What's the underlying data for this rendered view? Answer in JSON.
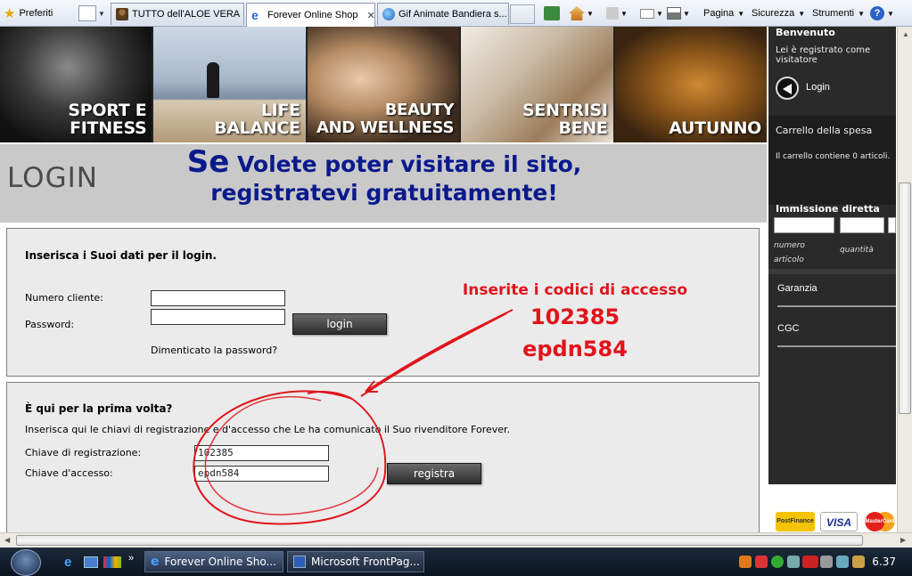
{
  "browser": {
    "favorites_label": "Preferiti",
    "tabs": [
      {
        "title": "TUTTO dell'ALOE VERA"
      },
      {
        "title": "Forever Online Shop",
        "active": true
      },
      {
        "title": "Gif Animate Bandiera s..."
      }
    ],
    "commands": {
      "page": "Pagina",
      "security": "Sicurezza",
      "tools": "Strumenti"
    }
  },
  "banner": {
    "items": [
      {
        "line1": "SPORT E",
        "line2": "FITNESS"
      },
      {
        "line1": "LIFE",
        "line2": "BALANCE"
      },
      {
        "line1": "BEAUTY",
        "line2": "AND WELLNESS"
      },
      {
        "line1": "SENTRISI",
        "line2": "BENE"
      },
      {
        "line1": "",
        "line2": "AUTUNNO"
      }
    ]
  },
  "title_area": {
    "heading": "LOGIN",
    "promo_big": "Se",
    "promo_line1": " Volete poter visitare il sito,",
    "promo_line2": "registratevi gratuitamente!"
  },
  "login_box": {
    "heading": "Inserisca i Suoi dati per il login.",
    "customer_number_label": "Numero cliente:",
    "customer_number_value": "",
    "password_label": "Password:",
    "password_value": "",
    "login_button": "login",
    "forgot_link": "Dimenticato la password?"
  },
  "register_box": {
    "heading": "È qui per la prima volta?",
    "instructions": "Inserisca qui le chiavi di registrazione e d'accesso che Le ha comunicato il Suo rivenditore Forever.",
    "reg_key_label": "Chiave di registrazione:",
    "reg_key_value": "102385",
    "access_key_label": "Chiave d'accesso:",
    "access_key_value": "epdn584",
    "register_button": "registra"
  },
  "annotation": {
    "title": "Inserite i codici di accesso",
    "code1": "102385",
    "code2": "epdn584",
    "color": "#e0141c"
  },
  "sidebar": {
    "welcome_title": "Benvenuto",
    "welcome_text": "Lei è registrato come visitatore",
    "login_label": "Login",
    "cart_title": "Carrello della spesa",
    "cart_text": "Il carrello contiene 0 articoli.",
    "direct_entry_title": "Immissione diretta",
    "article_number_label": "numero articolo",
    "quantity_label": "quantità",
    "warranty": "Garanzia",
    "cgc": "CGC"
  },
  "payments": [
    "PostFinance",
    "VISA",
    "MasterCard"
  ],
  "taskbar": {
    "windows": [
      {
        "title": "Forever Online Sho..."
      },
      {
        "title": "Microsoft FrontPag..."
      }
    ],
    "clock": "6.37"
  },
  "colors": {
    "promo": "#0a1a8c",
    "sidebar_bg": "#2a2a2a",
    "box_bg": "#ebebeb"
  }
}
